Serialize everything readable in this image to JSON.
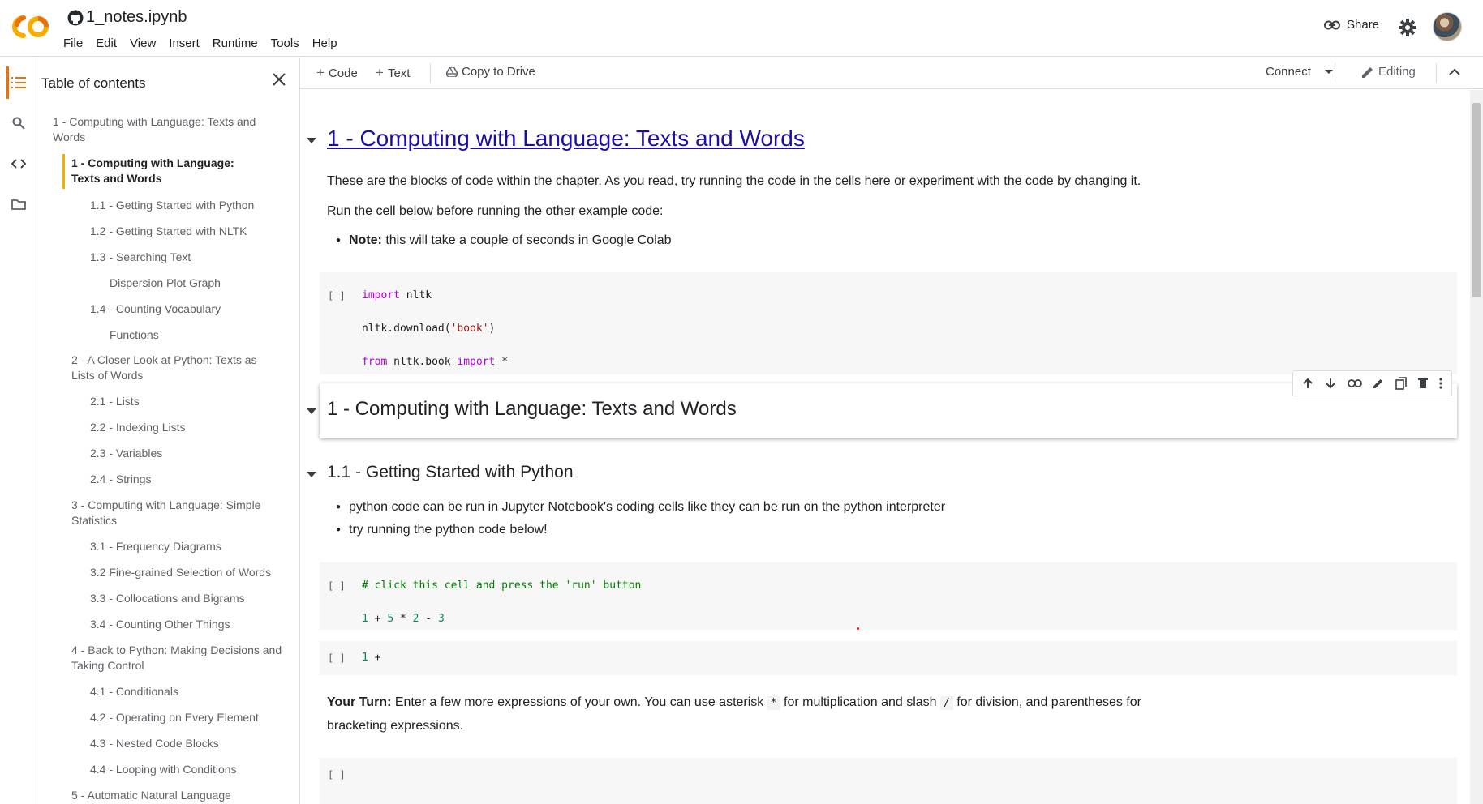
{
  "header": {
    "title": "1_notes.ipynb",
    "menu": [
      "File",
      "Edit",
      "View",
      "Insert",
      "Runtime",
      "Tools",
      "Help"
    ],
    "share_label": "Share",
    "brand_color": "#f9ab00"
  },
  "toc": {
    "title": "Table of contents",
    "items": [
      {
        "label": "1 - Computing with Language: Texts and Words"
      },
      {
        "label": "1 - Computing with Language: Texts and Words",
        "active": true
      },
      {
        "label": "1.1 - Getting Started with Python"
      },
      {
        "label": "1.2 - Getting Started with NLTK"
      },
      {
        "label": "1.3 - Searching Text"
      },
      {
        "label": "Dispersion Plot Graph"
      },
      {
        "label": "1.4 - Counting Vocabulary"
      },
      {
        "label": "Functions"
      },
      {
        "label": "2 - A Closer Look at Python: Texts as Lists of Words"
      },
      {
        "label": "2.1 - Lists"
      },
      {
        "label": "2.2 - Indexing Lists"
      },
      {
        "label": "2.3 - Variables"
      },
      {
        "label": "2.4 - Strings"
      },
      {
        "label": "3 - Computing with Language: Simple Statistics"
      },
      {
        "label": "3.1 - Frequency Diagrams"
      },
      {
        "label": "3.2 Fine-grained Selection of Words"
      },
      {
        "label": "3.3 - Collocations and Bigrams"
      },
      {
        "label": "3.4 - Counting Other Things"
      },
      {
        "label": "4 - Back to Python: Making Decisions and Taking Control"
      },
      {
        "label": "4.1 - Conditionals"
      },
      {
        "label": "4.2 - Operating on Every Element"
      },
      {
        "label": "4.3 - Nested Code Blocks"
      },
      {
        "label": "4.4 - Looping with Conditions"
      },
      {
        "label": "5 - Automatic Natural Language"
      }
    ]
  },
  "toolbar": {
    "add_code": "Code",
    "add_text": "Text",
    "copy_to_drive": "Copy to Drive",
    "connect": "Connect",
    "editing": "Editing"
  },
  "notebook": {
    "h1_title": "1 - Computing with Language: Texts and Words",
    "intro": "These are the blocks of code within the chapter. As you read, try running the code in the cells here or experiment with the code by changing it.",
    "run_first": "Run the cell below before running the other example code:",
    "note_label": "Note:",
    "note_text": " this will take a couple of seconds in Google Colab",
    "run_bracket": "[ ]",
    "cell1": {
      "l1_kw": "import",
      "l1_rest": " nltk",
      "l2_a": "nltk.download(",
      "l2_str": "'book'",
      "l2_b": ")",
      "l3_kw1": "from",
      "l3_mid": " nltk.book ",
      "l3_kw2": "import",
      "l3_rest": " *"
    },
    "section_heading": "1 - Computing with Language: Texts and Words",
    "sub_heading": "1.1 - Getting Started with Python",
    "bullet1": "python code can be run in Jupyter Notebook's coding cells like they can be run on the python interpreter",
    "bullet2": "try running the python code below!",
    "cell2": {
      "comment": "# click this cell and press the 'run' button",
      "n1": "1",
      "op1": " + ",
      "n2": "5",
      "op2": " * ",
      "n3": "2",
      "op3": " - ",
      "n4": "3"
    },
    "cell3": {
      "n1": "1",
      "rest": " +"
    },
    "your_turn_label": "Your Turn:",
    "your_turn_1": " Enter a few more expressions of your own. You can use asterisk ",
    "asterisk": "*",
    "your_turn_2": " for multiplication and slash ",
    "slash": "/",
    "your_turn_3": " for division, and parentheses for",
    "your_turn_4": "bracketing expressions."
  }
}
